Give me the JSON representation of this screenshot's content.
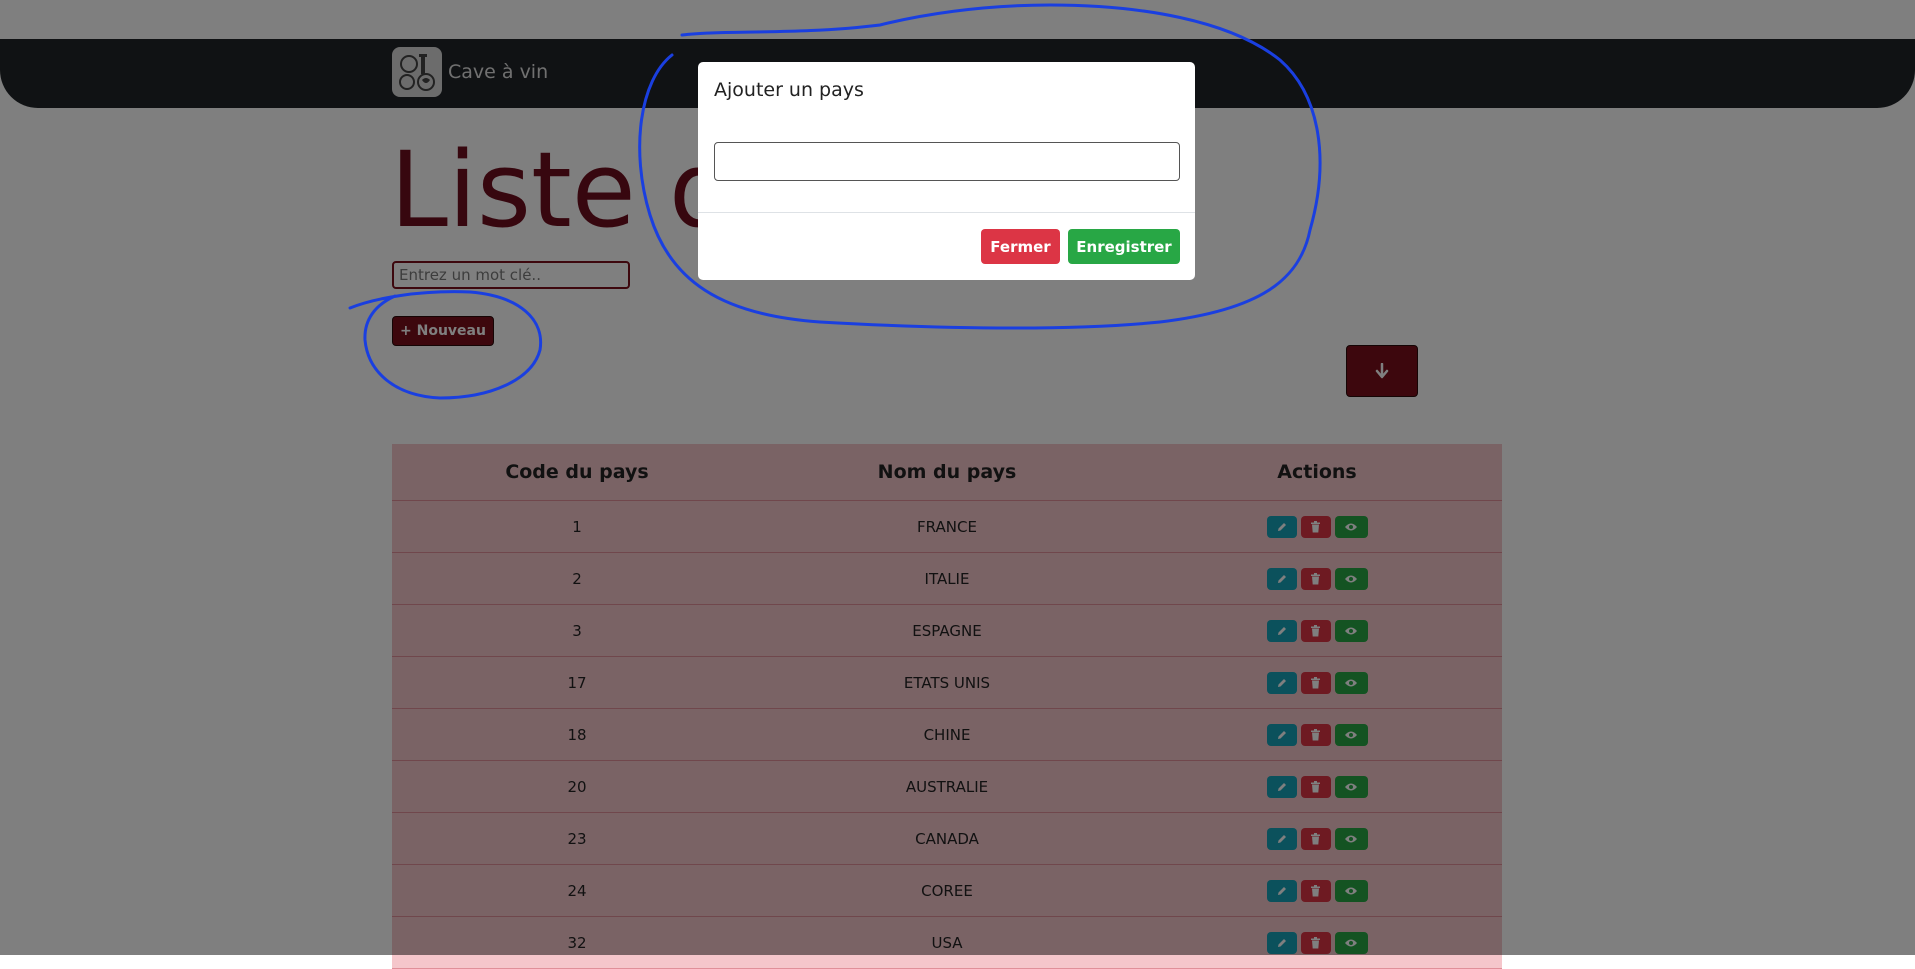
{
  "navbar": {
    "brand": "Cave à vin"
  },
  "page": {
    "title": "Liste d",
    "search_placeholder": "Entrez un mot clé..",
    "new_button": "+ Nouveau"
  },
  "table": {
    "headers": [
      "Code du pays",
      "Nom du pays",
      "Actions"
    ],
    "rows": [
      {
        "code": "1",
        "name": "FRANCE"
      },
      {
        "code": "2",
        "name": "ITALIE"
      },
      {
        "code": "3",
        "name": "ESPAGNE"
      },
      {
        "code": "17",
        "name": "ETATS UNIS"
      },
      {
        "code": "18",
        "name": "CHINE"
      },
      {
        "code": "20",
        "name": "AUSTRALIE"
      },
      {
        "code": "23",
        "name": "CANADA"
      },
      {
        "code": "24",
        "name": "COREE"
      },
      {
        "code": "32",
        "name": "USA"
      }
    ]
  },
  "modal": {
    "title": "Ajouter un pays",
    "input_value": "",
    "close_button": "Fermer",
    "save_button": "Enregistrer"
  },
  "colors": {
    "primary": "#7a0f1b",
    "navbar": "#212529",
    "table_bg": "#f5c6cb",
    "edit": "#17a2b8",
    "delete": "#dc3545",
    "view": "#28a745",
    "annotation": "#1a3fe0"
  },
  "icons": {
    "new_button": "plus-icon",
    "down_button": "arrow-down-icon",
    "row_actions": [
      "pencil-icon",
      "trash-icon",
      "eye-icon"
    ]
  }
}
